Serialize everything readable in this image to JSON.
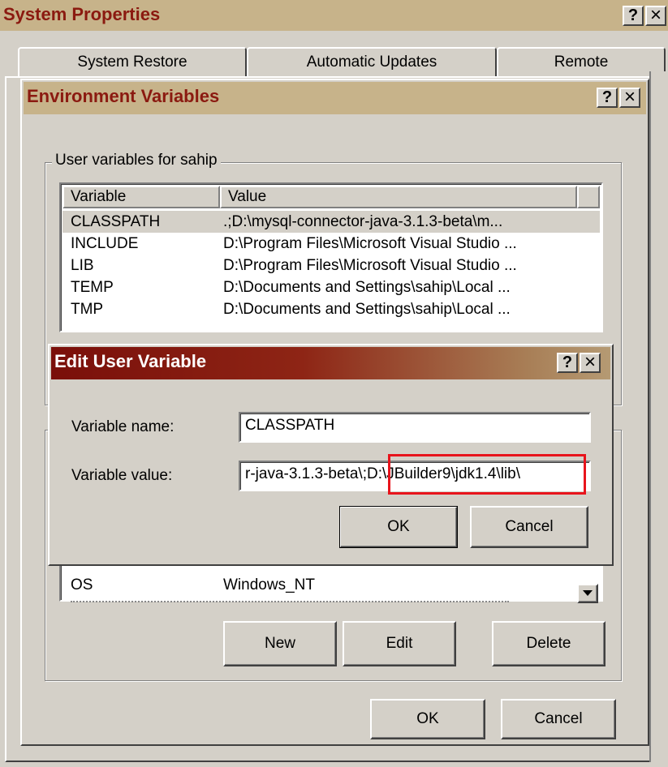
{
  "system_properties": {
    "title": "System Properties",
    "help": "?",
    "close": "×",
    "tabs": [
      "System Restore",
      "Automatic Updates",
      "Remote"
    ],
    "ok": "OK",
    "cancel": "Cancel"
  },
  "env_vars": {
    "title": "Environment Variables",
    "help": "?",
    "close": "×",
    "user_group_label": "User variables for sahip",
    "columns": [
      "Variable",
      "Value"
    ],
    "user_vars": [
      {
        "name": "CLASSPATH",
        "value": ".;D:\\mysql-connector-java-3.1.3-beta\\m..."
      },
      {
        "name": "INCLUDE",
        "value": "D:\\Program Files\\Microsoft Visual Studio ..."
      },
      {
        "name": "LIB",
        "value": "D:\\Program Files\\Microsoft Visual Studio ..."
      },
      {
        "name": "TEMP",
        "value": "D:\\Documents and Settings\\sahip\\Local ..."
      },
      {
        "name": "TMP",
        "value": "D:\\Documents and Settings\\sahip\\Local ..."
      }
    ],
    "system_vars_visible": [
      {
        "name": "OS",
        "value": "Windows_NT"
      }
    ],
    "new_button": "New",
    "edit_button": "Edit",
    "delete_button": "Delete",
    "ok": "OK",
    "cancel": "Cancel"
  },
  "edit_dialog": {
    "title": "Edit User Variable",
    "help": "?",
    "close": "×",
    "name_label": "Variable name:",
    "name_value": "CLASSPATH",
    "value_label": "Variable value:",
    "value_prefix": "r-java-3.1.3-beta\\",
    "value_highlighted": ";D:\\JBuilder9\\jdk1.4\\lib\\",
    "highlight_color": "#e8141c",
    "ok": "OK",
    "cancel": "Cancel"
  },
  "scroll_icon": "scroll-down-arrow",
  "colors": {
    "face": "#d4d0c8",
    "active_title": "#7a0f0a",
    "inactive_title": "#c7b38a",
    "inactive_title_text": "#8b1a10"
  }
}
